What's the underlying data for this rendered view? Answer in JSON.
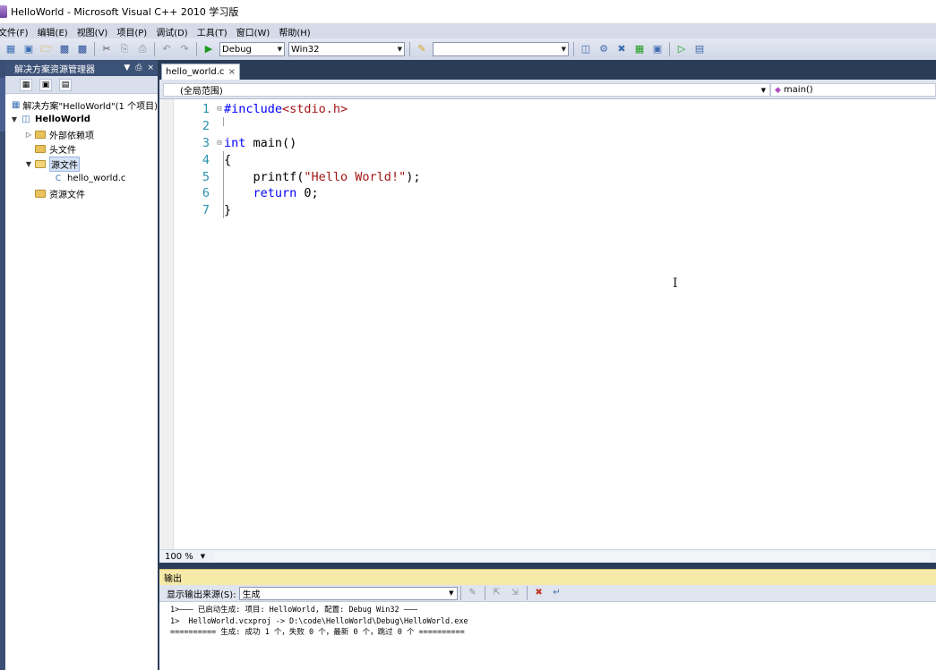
{
  "window": {
    "title": "HelloWorld - Microsoft Visual C++ 2010 学习版"
  },
  "menu": [
    "文件(F)",
    "编辑(E)",
    "视图(V)",
    "项目(P)",
    "调试(D)",
    "工具(T)",
    "窗口(W)",
    "帮助(H)"
  ],
  "toolbar": {
    "config_value": "Debug",
    "platform_value": "Win32",
    "find_value": ""
  },
  "solution_explorer": {
    "title": "解决方案资源管理器",
    "pin": "ㅁ",
    "close": "×",
    "items": [
      {
        "label": "解决方案\"HelloWorld\"(1 个项目)",
        "depth": 0
      },
      {
        "label": "HelloWorld",
        "depth": 1
      },
      {
        "label": "外部依赖项",
        "depth": 2
      },
      {
        "label": "头文件",
        "depth": 2
      },
      {
        "label": "源文件",
        "depth": 2
      },
      {
        "label": "hello_world.c",
        "depth": 3
      },
      {
        "label": "资源文件",
        "depth": 2
      }
    ]
  },
  "editor": {
    "tab_label": "hello_world.c",
    "tab_close": "×",
    "scope": "(全局范围)",
    "function": "main()",
    "line_numbers": [
      "1",
      "2",
      "3",
      "4",
      "5",
      "6",
      "7"
    ],
    "lines": {
      "l1_pp": "#include",
      "l1_hdr": "<stdio.h>",
      "l3_kw": "int",
      "l3_rest": " main()",
      "l4": "{",
      "l5_call": "    printf(",
      "l5_str": "\"Hello World!\"",
      "l5_end": ");",
      "l6_kw": "    return",
      "l6_rest": " 0;",
      "l7": "}"
    },
    "zoom": "100 %"
  },
  "output": {
    "title": "输出",
    "source_label": "显示输出来源(S):",
    "source_value": "生成",
    "lines": [
      "1>——— 已启动生成: 项目: HelloWorld, 配置: Debug Win32 ———",
      "1>  HelloWorld.vcxproj -> D:\\code\\HelloWorld\\Debug\\HelloWorld.exe",
      "========== 生成: 成功 1 个，失败 0 个，最新 0 个，跳过 0 个 =========="
    ]
  },
  "icons": {
    "new": "new-project-icon",
    "open": "open-folder-icon",
    "save": "save-icon",
    "cut": "cut-icon",
    "start": "start-debug-icon",
    "ibeam": "text-cursor-icon"
  }
}
